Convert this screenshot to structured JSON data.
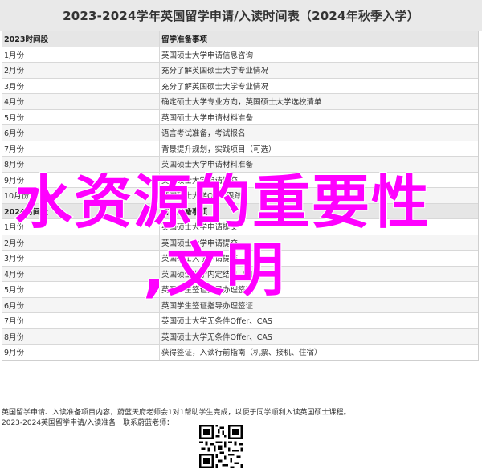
{
  "title": "2023-2024学年英国留学申请/入读时间表（2024年秋季入学）",
  "section1": {
    "header": {
      "col1": "2023时间段",
      "col2": "留学准备事项"
    },
    "rows": [
      {
        "col1": "1月份",
        "col2": "英国硕士大学申请信息咨询"
      },
      {
        "col1": "2月份",
        "col2": "充分了解英国硕士大学专业情况"
      },
      {
        "col1": "3月份",
        "col2": "充分了解英国硕士大学专业情况"
      },
      {
        "col1": "4月份",
        "col2": "确定硕士大学专业方向，英国硕士大学选校清单"
      },
      {
        "col1": "5月份",
        "col2": "英国硕士大学申请材料准备"
      },
      {
        "col1": "6月份",
        "col2": "语言考试准备，考试报名"
      },
      {
        "col1": "7月份",
        "col2": "背景提升规划，实践项目（可选）"
      },
      {
        "col1": "8月份",
        "col2": "英国硕士大学申请材料准备"
      },
      {
        "col1": "9月份",
        "col2": "英国硕士大学申请提交"
      },
      {
        "col1": "10月份",
        "col2": "英国硕士大学Offer跟踪"
      }
    ]
  },
  "section2": {
    "header": {
      "col1": "2024时间段",
      "col2": "留学准备事项"
    },
    "rows": [
      {
        "col1": "1月份",
        "col2": "英国硕士大学申请提交"
      },
      {
        "col1": "2月份",
        "col2": "英国硕士大学申请提交"
      },
      {
        "col1": "3月份",
        "col2": "英国硕士大学申请提交"
      },
      {
        "col1": "4月份",
        "col2": "英国硕士大学内定结果（可选）"
      },
      {
        "col1": "5月份",
        "col2": "英国学生签证指导办理签证"
      },
      {
        "col1": "6月份",
        "col2": "英国学生签证指导办理签证"
      },
      {
        "col1": "7月份",
        "col2": "英国硕士大学无条件Offer、CAS"
      },
      {
        "col1": "8月份",
        "col2": "英国硕士大学无条件Offer、CAS"
      },
      {
        "col1": "9月份",
        "col2": "获得签证，入读行前指南（机票、接机、住宿）"
      }
    ]
  },
  "footer": {
    "line1": "英国留学申请、入读准备项目内容，蔚蓝天府老师会1对1帮助学生完成，以便于同学顺利入读英国硕士课程。",
    "line2": "2023-2024英国留学申请/入读准备一联系蔚蓝老师："
  },
  "overlay": {
    "line1": "水资源的重要性",
    "line2": ",文明"
  },
  "colors": {
    "overlay": "#ff00ff",
    "header_bg": "#e6e6e6",
    "title_bg": "#e9e9e9"
  }
}
